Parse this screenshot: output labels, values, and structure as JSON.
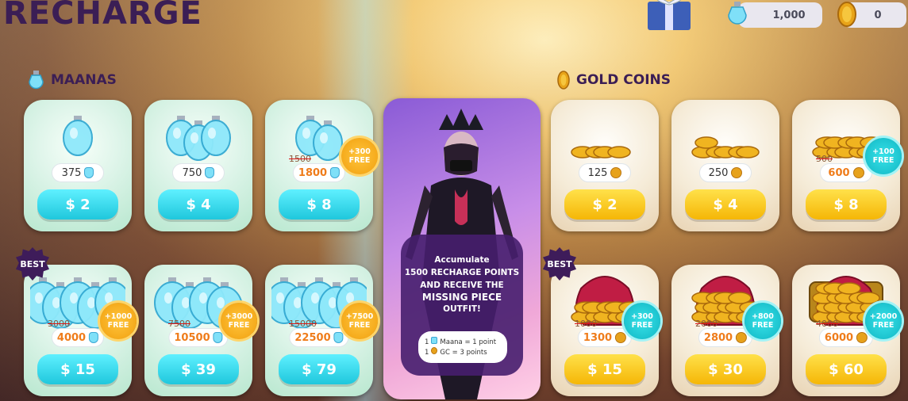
{
  "title": "RECHARGE",
  "hud": {
    "maana_balance": "1,000",
    "gold_balance": "0"
  },
  "sections": {
    "maanas": "MAANAS",
    "gold_coins": "GOLD COINS"
  },
  "promo": {
    "line1": "Accumulate",
    "line2": "1500 RECHARGE POINTS",
    "line3": "AND RECEIVE THE",
    "line4": "MISSING PIECE",
    "line5": "OUTFIT!",
    "legend1": "Maana = 1 point",
    "legend2_prefix": "1",
    "legend2": "GC = 3 points",
    "legend1_prefix": "1"
  },
  "maana_packs": [
    {
      "amount": "375",
      "price": "$ 2"
    },
    {
      "amount": "750",
      "price": "$ 4"
    },
    {
      "old": "1500",
      "amount": "1800",
      "price": "$ 8",
      "badge1": "+300",
      "badge2": "FREE"
    },
    {
      "old": "3000",
      "amount": "4000",
      "price": "$ 15",
      "badge1": "+1000",
      "badge2": "FREE",
      "best": "BEST"
    },
    {
      "old": "7500",
      "amount": "10500",
      "price": "$ 39",
      "badge1": "+3000",
      "badge2": "FREE"
    },
    {
      "old": "15000",
      "amount": "22500",
      "price": "$ 79",
      "badge1": "+7500",
      "badge2": "FREE"
    }
  ],
  "gold_packs": [
    {
      "amount": "125",
      "price": "$ 2"
    },
    {
      "amount": "250",
      "price": "$ 4"
    },
    {
      "old": "500",
      "amount": "600",
      "price": "$ 8",
      "badge1": "+100",
      "badge2": "FREE"
    },
    {
      "old": "1000",
      "amount": "1300",
      "price": "$ 15",
      "badge1": "+300",
      "badge2": "FREE",
      "best": "BEST"
    },
    {
      "old": "2000",
      "amount": "2800",
      "price": "$ 30",
      "badge1": "+800",
      "badge2": "FREE"
    },
    {
      "old": "4000",
      "amount": "6000",
      "price": "$ 60",
      "badge1": "+2000",
      "badge2": "FREE"
    }
  ],
  "colors": {
    "mana_button": "#1fc7dc",
    "gold_button": "#f5b606",
    "title": "#3b1e55",
    "badge_orange": "#f19f0d",
    "badge_teal": "#10b6c4"
  }
}
